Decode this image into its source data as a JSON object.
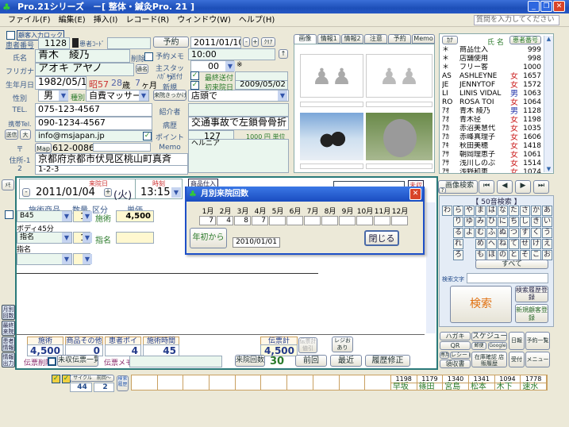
{
  "window": {
    "title": "Pro.21シリーズ　－[ 整体・鍼灸Pro. 21 ]",
    "help_placeholder": "質問を入力してください"
  },
  "menu": [
    "ファイル(F)",
    "編集(E)",
    "挿入(I)",
    "レコード(R)",
    "ウィンドウ(W)",
    "ヘルプ(H)"
  ],
  "form": {
    "lock_label": "顧客入力ロック",
    "patient_no_label": "患者番号",
    "patient_no": "1128",
    "patient_code_label": "患者ｺｰﾄﾞ",
    "patient_code": "",
    "name_label": "氏名",
    "name": "青木　綾乃",
    "delete_label": "削除",
    "furigana_label": "フリガナ",
    "furigana": "アオキ アヤノ",
    "alias_button": "通名",
    "birth_label": "生年月日",
    "birth": "1982/05/15",
    "era": "昭57",
    "age": "28",
    "age_unit": "歳",
    "months": "7",
    "months_unit": "ヶ月",
    "sex_label": "性別",
    "sex": "男",
    "type_label": "種別",
    "type": "自費マッサージ",
    "visit_reason_button": "来院きっかけ",
    "visit_reason": "店頭で",
    "tel_label": "TEL.",
    "tel": "075-123-4567",
    "mobile_label": "携帯Tel.",
    "mobile": "090-1234-4567",
    "send_button": "送信",
    "large_button": "大",
    "email": "info@msjapan.jp",
    "zip_label": "〒",
    "map_button": "Map",
    "zip": "612-0086",
    "address1_label": "住所-1",
    "address1": "京都府京都市伏見区桃山町真斉",
    "address2_label": "2",
    "address2": "1-2-3",
    "reserve_button": "予約",
    "reserve_date": "2011/01/10",
    "minus": "-",
    "plus": "+",
    "clear_button": "ｸﾘｱ",
    "reserve_memo_label": "予約メモ",
    "reserve_memo": "10:00",
    "staff_label": "主スタッフ",
    "staff": "00",
    "staff_mark": "※",
    "postcard_label": "ﾊｶﾞｷ送付",
    "last_sent_label": "最終送付",
    "last_sent": "",
    "new_label": "新規",
    "first_visit_label": "初来院日",
    "first_visit": "2009/05/02",
    "referrer_label": "紹介者",
    "referrer": "",
    "history_label": "病歴",
    "history": "交通事故で左鎖骨骨折",
    "point_label": "ポイント",
    "point": "127",
    "point_unit": "1000 円 単位",
    "memo_label": "Memo",
    "memo": "ヘルニア"
  },
  "image_tabs": [
    "画像",
    "情報1",
    "情報2",
    "注意",
    "予約",
    "Memo"
  ],
  "patient_list": {
    "headers": [
      "ｶﾅ",
      "氏 名",
      "患者番号"
    ],
    "rows": [
      [
        "＊",
        "商品仕入",
        "",
        "999"
      ],
      [
        "＊",
        "店舗使用",
        "",
        "998"
      ],
      [
        "＊",
        "フリー客",
        "",
        "1000"
      ],
      [
        "AS",
        "ASHLEYNE",
        "女",
        "1657"
      ],
      [
        "JE",
        "JENNYTOF",
        "女",
        "1572"
      ],
      [
        "LI",
        "LINIS VIDAL",
        "男",
        "1063"
      ],
      [
        "RO",
        "ROSA TOI",
        "女",
        "1064"
      ],
      [
        "ｱｵ",
        "青木 綾乃",
        "男",
        "1128"
      ],
      [
        "ｱｵ",
        "青木径",
        "女",
        "1198"
      ],
      [
        "ｱｶ",
        "赤沼美慧代",
        "女",
        "1035"
      ],
      [
        "ｱｶ",
        "赤峰真理子",
        "女",
        "1606"
      ],
      [
        "ｱｷ",
        "秋田美穂",
        "女",
        "1418"
      ],
      [
        "ｱｻ",
        "朝岡理恵子",
        "女",
        "1061"
      ],
      [
        "ｱｻ",
        "浅川しのぶ",
        "女",
        "1514"
      ],
      [
        "ｱｻ",
        "浅野和恵",
        "女",
        "1074"
      ],
      [
        "ｱｻ",
        "浅野祐",
        "女",
        "1482"
      ]
    ],
    "female_color": "#cc2222",
    "male_color": "#2233aa"
  },
  "visit": {
    "date_label": "来院日",
    "date": "2011/01/04",
    "weekday": "(火)",
    "time_label": "時刻",
    "time": "13:15",
    "purchase_tab": "商品仕入",
    "unpaid_label": "未収",
    "memo_button": "ﾒﾓ",
    "columns": [
      "施術商品",
      "数量",
      "区分",
      "単価"
    ],
    "items": [
      {
        "code": "B45",
        "qty": "1",
        "kind": "施術",
        "price": "4,500",
        "desc": "ボディ45分"
      },
      {
        "code": "指名",
        "qty": "1",
        "kind": "指名",
        "price": "",
        "desc": "指名"
      }
    ]
  },
  "side_buttons": [
    "月別回数",
    "最終来院",
    "患者情報",
    "情報出力"
  ],
  "modal": {
    "title": "月別来院回数",
    "months": [
      "1月",
      "2月",
      "3月",
      "4月",
      "5月",
      "6月",
      "7月",
      "8月",
      "9月",
      "10月",
      "11月",
      "12月"
    ],
    "counts": [
      "7",
      "4",
      "8",
      "7",
      "",
      "",
      "",
      "",
      "",
      "",
      "",
      ""
    ],
    "from_start_button": "年初から",
    "from_date": "2010/01/01",
    "close_button": "閉じる"
  },
  "totals": {
    "treatment_label": "施術",
    "treatment": "4,500",
    "goods_label": "商品その他",
    "goods": "0",
    "points_label": "患者ポイント",
    "points": "4",
    "duration_label": "施術時間",
    "duration": "45",
    "slip_total_label": "伝票計",
    "slip_total": "4,500",
    "discount_label": "伝票計値引",
    "register_button": "レジおあり",
    "slip_delete_label": "伝票削除",
    "unpaid_list_button": "未収伝票一覧",
    "slip_memo_label": "伝票メモ",
    "slip_memo": "",
    "visit_count_button": "来院回数",
    "visit_count": "30",
    "prev_button": "前回",
    "recent_button": "最近",
    "history_edit_button": "履歴修正"
  },
  "search": {
    "help": "?",
    "image_search": "画像検索",
    "first": "⏮",
    "prev": "◀",
    "next": "▶",
    "last": "⏭",
    "kana_title": "【 50音検索 】",
    "kana": [
      "わ",
      "ら",
      "や",
      "ま",
      "は",
      "な",
      "た",
      "さ",
      "か",
      "あ",
      "",
      "り",
      "ゆ",
      "み",
      "ひ",
      "に",
      "ち",
      "し",
      "き",
      "い",
      "",
      "る",
      "よ",
      "む",
      "ふ",
      "ぬ",
      "つ",
      "す",
      "く",
      "う",
      "",
      "れ",
      "",
      "め",
      "へ",
      "ね",
      "て",
      "せ",
      "け",
      "え",
      "",
      "ろ",
      "",
      "も",
      "ほ",
      "の",
      "と",
      "そ",
      "こ",
      "お"
    ],
    "all_button": "すべて",
    "text_label": "検索文字",
    "text": "",
    "search_button": "検索",
    "history_register": "検索履歴登録",
    "new_customer": "新規顧客登録"
  },
  "tools": {
    "postcard": "ハガキ",
    "qr": "QR",
    "schedule": "スケジュール",
    "postal": "郵便",
    "google": "Google",
    "daily": "日報",
    "reserve_list": "予約一覧",
    "dedicated": "専用",
    "receipt": "レシート",
    "invoice": "領収書",
    "stock": "在庫確認 店販履歴",
    "reception": "受付",
    "menu": "メニュー"
  },
  "cycle": {
    "cycle_label": "サイクル",
    "prev_label": "前回～",
    "cycle": "44",
    "prev": "2",
    "history_search": "検索履歴"
  },
  "recent_patients": [
    [
      "1198",
      "早坂"
    ],
    [
      "1179",
      "篠田"
    ],
    [
      "1340",
      "宮島"
    ],
    [
      "1341",
      "松本"
    ],
    [
      "1094",
      "木下"
    ],
    [
      "1778",
      "速水"
    ]
  ]
}
